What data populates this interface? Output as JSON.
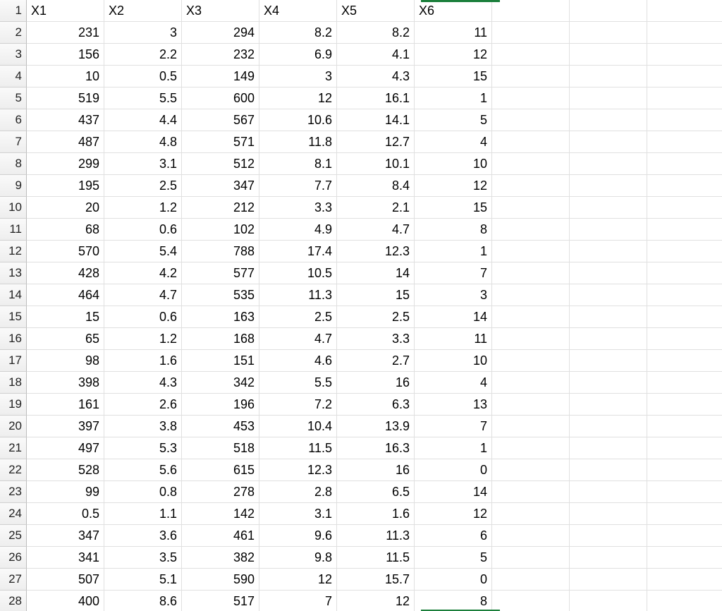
{
  "headers": [
    "X1",
    "X2",
    "X3",
    "X4",
    "X5",
    "X6"
  ],
  "rows": [
    [
      231,
      3,
      294,
      8.2,
      8.2,
      11
    ],
    [
      156,
      2.2,
      232,
      6.9,
      4.1,
      12
    ],
    [
      10,
      0.5,
      149,
      3,
      4.3,
      15
    ],
    [
      519,
      5.5,
      600,
      12,
      16.1,
      1
    ],
    [
      437,
      4.4,
      567,
      10.6,
      14.1,
      5
    ],
    [
      487,
      4.8,
      571,
      11.8,
      12.7,
      4
    ],
    [
      299,
      3.1,
      512,
      8.1,
      10.1,
      10
    ],
    [
      195,
      2.5,
      347,
      7.7,
      8.4,
      12
    ],
    [
      20,
      1.2,
      212,
      3.3,
      2.1,
      15
    ],
    [
      68,
      0.6,
      102,
      4.9,
      4.7,
      8
    ],
    [
      570,
      5.4,
      788,
      17.4,
      12.3,
      1
    ],
    [
      428,
      4.2,
      577,
      10.5,
      14,
      7
    ],
    [
      464,
      4.7,
      535,
      11.3,
      15,
      3
    ],
    [
      15,
      0.6,
      163,
      2.5,
      2.5,
      14
    ],
    [
      65,
      1.2,
      168,
      4.7,
      3.3,
      11
    ],
    [
      98,
      1.6,
      151,
      4.6,
      2.7,
      10
    ],
    [
      398,
      4.3,
      342,
      5.5,
      16,
      4
    ],
    [
      161,
      2.6,
      196,
      7.2,
      6.3,
      13
    ],
    [
      397,
      3.8,
      453,
      10.4,
      13.9,
      7
    ],
    [
      497,
      5.3,
      518,
      11.5,
      16.3,
      1
    ],
    [
      528,
      5.6,
      615,
      12.3,
      16,
      0
    ],
    [
      99,
      0.8,
      278,
      2.8,
      6.5,
      14
    ],
    [
      0.5,
      1.1,
      142,
      3.1,
      1.6,
      12
    ],
    [
      347,
      3.6,
      461,
      9.6,
      11.3,
      6
    ],
    [
      341,
      3.5,
      382,
      9.8,
      11.5,
      5
    ],
    [
      507,
      5.1,
      590,
      12,
      15.7,
      0
    ],
    [
      400,
      8.6,
      517,
      7,
      12,
      8
    ]
  ],
  "totalDataCols": 9,
  "selection": {
    "column_index": 5
  },
  "colors": {
    "selection_border": "#1b7f3b"
  }
}
